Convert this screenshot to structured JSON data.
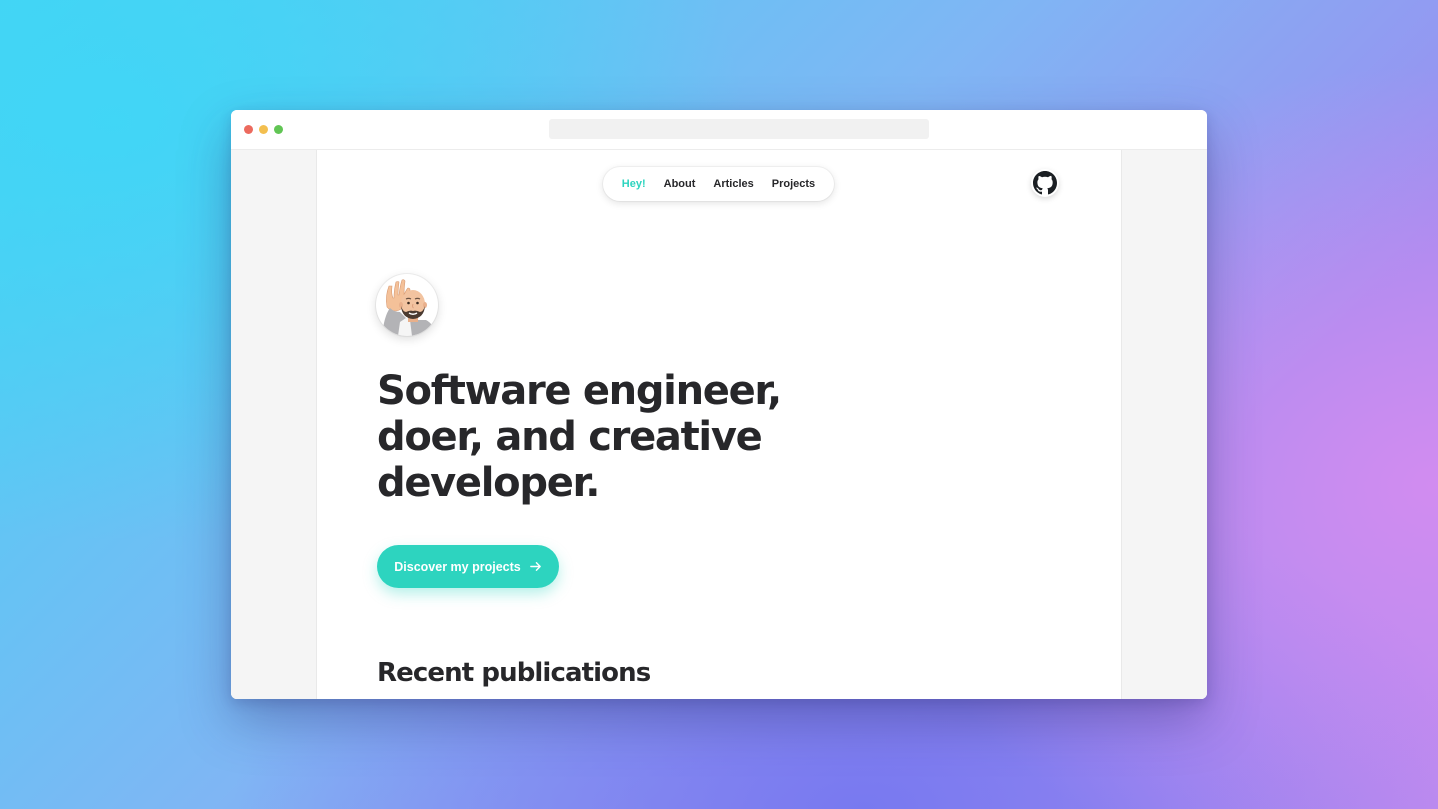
{
  "nav": {
    "items": [
      {
        "label": "Hey!",
        "active": true
      },
      {
        "label": "About",
        "active": false
      },
      {
        "label": "Articles",
        "active": false
      },
      {
        "label": "Projects",
        "active": false
      }
    ]
  },
  "hero": {
    "headline_lines": [
      "Software engineer,",
      "doer, and creative",
      "developer."
    ],
    "cta_label": "Discover my projects",
    "cta_icon": "arrow-right-icon"
  },
  "section": {
    "recent_title": "Recent publications"
  },
  "icons": {
    "header_right": "github-icon",
    "avatar": "memoji-waving-avatar"
  },
  "colors": {
    "accent": "#2dd4bf",
    "text": "#27272a",
    "window_dots": [
      "#ec6a5e",
      "#f3bf4f",
      "#61c554"
    ]
  }
}
